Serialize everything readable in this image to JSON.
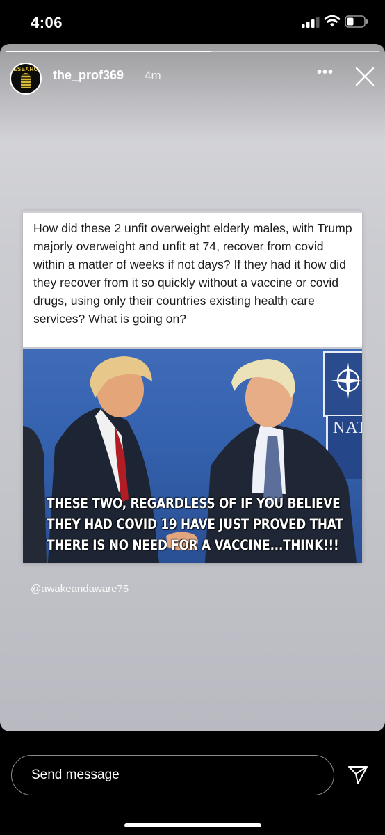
{
  "status_bar": {
    "time": "4:06",
    "icons": [
      "cellular-signal-icon",
      "wifi-icon",
      "battery-icon"
    ]
  },
  "story": {
    "progress": 0.55,
    "username": "the_prof369",
    "time_ago": "4m",
    "more_label": "•••",
    "avatar_text": "ESEARC",
    "icons": [
      "more-options-icon",
      "close-icon"
    ]
  },
  "post": {
    "body_text": "How did these 2 unfit overweight elderly males, with Trump majorly overweight and unfit at 74, recover from covid within a matter of weeks if not days? If they had it how did they recover from it so quickly without a vaccine or covid drugs, using only their countries existing health care services? What is going on?",
    "image_caption_lines": [
      "THESE TWO, REGARDLESS OF IF YOU BELIEVE",
      "THEY HAD COVID 19 HAVE JUST PROVED THAT",
      "THERE IS NO NEED FOR A VACCINE...THINK!!!"
    ],
    "background_sign_text": "NAT",
    "source_handle": "@awakeandaware75"
  },
  "reply": {
    "placeholder": "Send message",
    "send_icon": "send-paper-plane-icon"
  },
  "colors": {
    "background": "#000000",
    "story_gradient_top": "#d9d9dd",
    "story_gradient_bottom": "#b9bac1",
    "caption_text": "#ffffff"
  }
}
